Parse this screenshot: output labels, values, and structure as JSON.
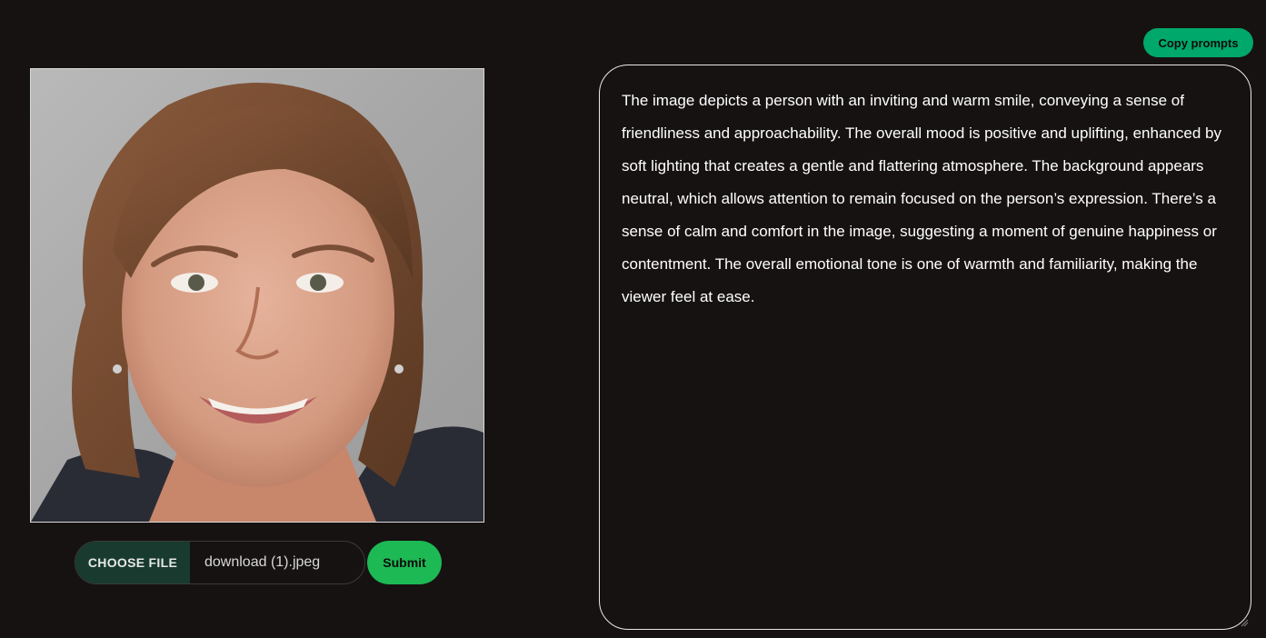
{
  "upload": {
    "choose_file_label": "CHOOSE FILE",
    "file_name": "download (1).jpeg",
    "submit_label": "Submit"
  },
  "image": {
    "alt": "Uploaded portrait photo"
  },
  "output": {
    "copy_label": "Copy prompts",
    "text": "The image depicts a person with an inviting and warm smile, conveying a sense of friendliness and approachability. The overall mood is positive and uplifting, enhanced by soft lighting that creates a gentle and flattering atmosphere. The background appears neutral, which allows attention to remain focused on the person’s expression. There’s a sense of calm and comfort in the image, suggesting a moment of genuine happiness or contentment. The overall emotional tone is one of warmth and familiarity, making the viewer feel at ease."
  },
  "colors": {
    "background": "#161212",
    "accent_green": "#1db954",
    "copy_green": "#00a86b",
    "choose_file_bg": "#183a2f"
  }
}
